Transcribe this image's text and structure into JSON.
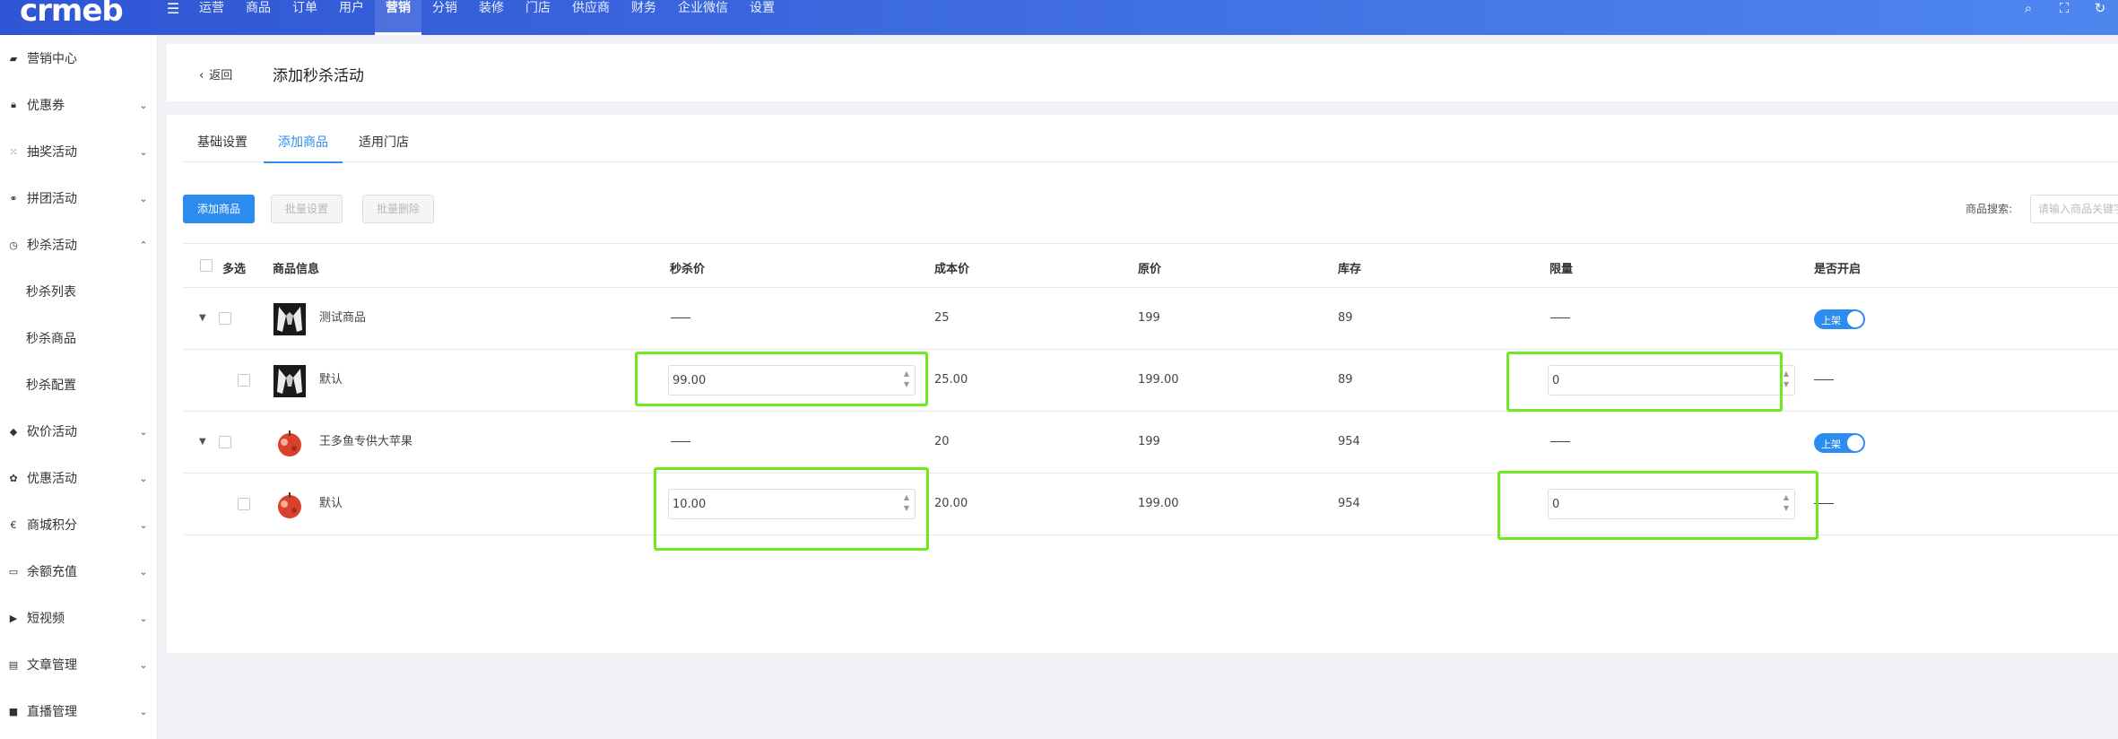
{
  "brand": {
    "logo": "crmeb"
  },
  "nav": [
    "运营",
    "商品",
    "订单",
    "用户",
    "营销",
    "分销",
    "装修",
    "门店",
    "供应商",
    "财务",
    "企业微信",
    "设置"
  ],
  "sidebar": {
    "items": [
      {
        "label": "营销中心",
        "icon": "store-icon"
      },
      {
        "label": "优惠券",
        "icon": "lock-icon"
      },
      {
        "label": "抽奖活动",
        "icon": "grid-icon"
      },
      {
        "label": "拼团活动",
        "icon": "group-icon"
      },
      {
        "label": "秒杀活动",
        "icon": "clock-icon"
      },
      {
        "label": "砍价活动",
        "icon": "tag-icon"
      },
      {
        "label": "优惠活动",
        "icon": "gift-icon"
      },
      {
        "label": "商城积分",
        "icon": "euro-icon"
      },
      {
        "label": "余额充值",
        "icon": "card-icon"
      },
      {
        "label": "短视频",
        "icon": "video-icon"
      },
      {
        "label": "文章管理",
        "icon": "doc-icon"
      },
      {
        "label": "直播管理",
        "icon": "camera-icon"
      }
    ],
    "sub_items": [
      "秒杀列表",
      "秒杀商品",
      "秒杀配置"
    ]
  },
  "header": {
    "back": "返回",
    "title": "添加秒杀活动"
  },
  "tabs": [
    "基础设置",
    "添加商品",
    "适用门店"
  ],
  "toolbar": {
    "add": "添加商品",
    "batch_set": "批量设置",
    "batch_delete": "批量删除",
    "search_label": "商品搜索:",
    "search_placeholder": "请输入商品关键字"
  },
  "table": {
    "headers": [
      "多选",
      "商品信息",
      "秒杀价",
      "成本价",
      "原价",
      "库存",
      "限量",
      "是否开启"
    ],
    "rows": [
      {
        "name": "测试商品",
        "cost": "25",
        "price": "199",
        "stock": "89",
        "status": "上架",
        "sku": {
          "name": "默认",
          "seckill": "99.00",
          "cost": "25.00",
          "price": "199.00",
          "stock": "89",
          "limit": "0"
        }
      },
      {
        "name": "王多鱼专供大苹果",
        "cost": "20",
        "price": "199",
        "stock": "954",
        "status": "上架",
        "sku": {
          "name": "默认",
          "seckill": "10.00",
          "cost": "20.00",
          "price": "199.00",
          "stock": "954",
          "limit": "0"
        }
      }
    ]
  },
  "colors": {
    "primary": "#2d8cf0",
    "highlight": "#6dea1e",
    "topbar_start": "#2f55d4",
    "topbar_end": "#4f86ee"
  }
}
